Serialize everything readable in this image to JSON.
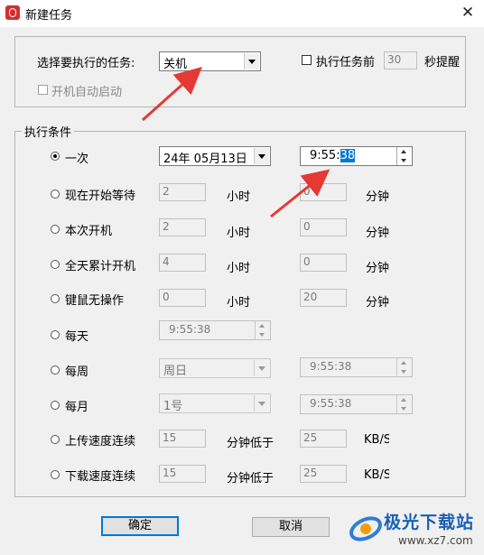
{
  "window": {
    "title": "新建任务",
    "close_glyph": "✕"
  },
  "task_select": {
    "label": "选择要执行的任务:",
    "value": "关机"
  },
  "remind": {
    "label": "执行任务前",
    "value": "30",
    "suffix": "秒提醒",
    "checked": false
  },
  "autostart": {
    "label": "开机自动启动",
    "checked": false,
    "disabled": true
  },
  "conditions": {
    "legend": "执行条件",
    "once": {
      "label": "一次",
      "date": "24年 05月13日",
      "time_prefix": "9:55:",
      "time_sec": "38",
      "selected": true
    },
    "from_now": {
      "label": "现在开始等待",
      "hours": "2",
      "hours_unit": "小时",
      "minutes": "0",
      "minutes_unit": "分钟"
    },
    "this_boot": {
      "label": "本次开机",
      "hours": "2",
      "hours_unit": "小时",
      "minutes": "0",
      "minutes_unit": "分钟"
    },
    "day_total": {
      "label": "全天累计开机",
      "hours": "4",
      "hours_unit": "小时",
      "minutes": "0",
      "minutes_unit": "分钟"
    },
    "idle": {
      "label": "键鼠无操作",
      "hours": "0",
      "hours_unit": "小时",
      "minutes": "20",
      "minutes_unit": "分钟"
    },
    "daily": {
      "label": "每天",
      "time": "9:55:38"
    },
    "weekly": {
      "label": "每周",
      "day": "周日",
      "time": "9:55:38"
    },
    "monthly": {
      "label": "每月",
      "day": "1号",
      "time": "9:55:38"
    },
    "upload": {
      "label": "上传速度连续",
      "minutes": "15",
      "mid": "分钟低于",
      "speed": "25",
      "unit": "KB/S"
    },
    "download": {
      "label": "下载速度连续",
      "minutes": "15",
      "mid": "分钟低于",
      "speed": "25",
      "unit": "KB/S"
    }
  },
  "buttons": {
    "ok": "确定",
    "cancel": "取消"
  },
  "watermark": {
    "brand": "极光下载站",
    "url": "www.xz7.com"
  },
  "colors": {
    "accent": "#0078d7",
    "arrow": "#e53935",
    "icon": "#d32f2f"
  }
}
